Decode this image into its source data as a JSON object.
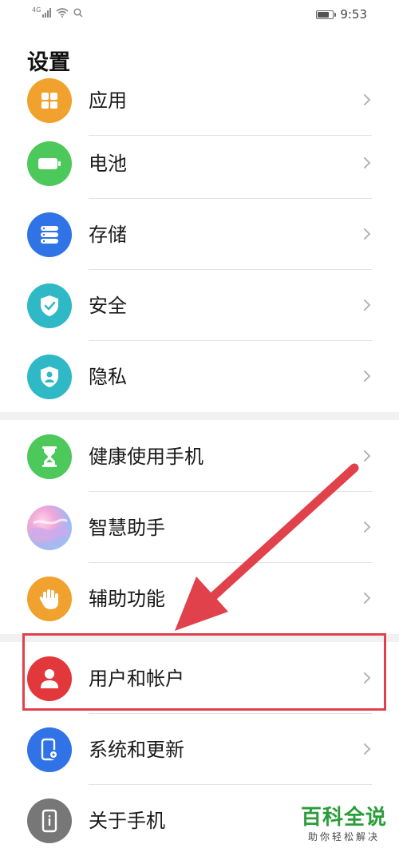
{
  "status_bar": {
    "network": "4G",
    "time": "9:53",
    "battery_level": 0.8
  },
  "header": {
    "title": "设置"
  },
  "items": [
    {
      "id": "apps",
      "label": "应用",
      "icon": "apps-icon",
      "color": "#f0a12e"
    },
    {
      "id": "battery",
      "label": "电池",
      "icon": "battery-icon",
      "color": "#4cc95a"
    },
    {
      "id": "storage",
      "label": "存储",
      "icon": "storage-icon",
      "color": "#2f73e6"
    },
    {
      "id": "security",
      "label": "安全",
      "icon": "shield-icon",
      "color": "#2fb8c6"
    },
    {
      "id": "privacy",
      "label": "隐私",
      "icon": "privacy-icon",
      "color": "#2fb8c6"
    },
    {
      "id": "digital-balance",
      "label": "健康使用手机",
      "icon": "hourglass-icon",
      "color": "#4cc95a"
    },
    {
      "id": "assistant",
      "label": "智慧助手",
      "icon": "assistant-icon",
      "color": "#b9a6e8"
    },
    {
      "id": "accessibility",
      "label": "辅助功能",
      "icon": "hand-icon",
      "color": "#f0a12e"
    },
    {
      "id": "users",
      "label": "用户和帐户",
      "icon": "user-icon",
      "color": "#e2383c"
    },
    {
      "id": "system",
      "label": "系统和更新",
      "icon": "phone-gear-icon",
      "color": "#2f73e6"
    },
    {
      "id": "about",
      "label": "关于手机",
      "icon": "phone-info-icon",
      "color": "#777777"
    }
  ],
  "annotation": {
    "color": "#e0414a"
  },
  "watermark": {
    "title": "百科全说",
    "subtitle": "助你轻松解决"
  }
}
